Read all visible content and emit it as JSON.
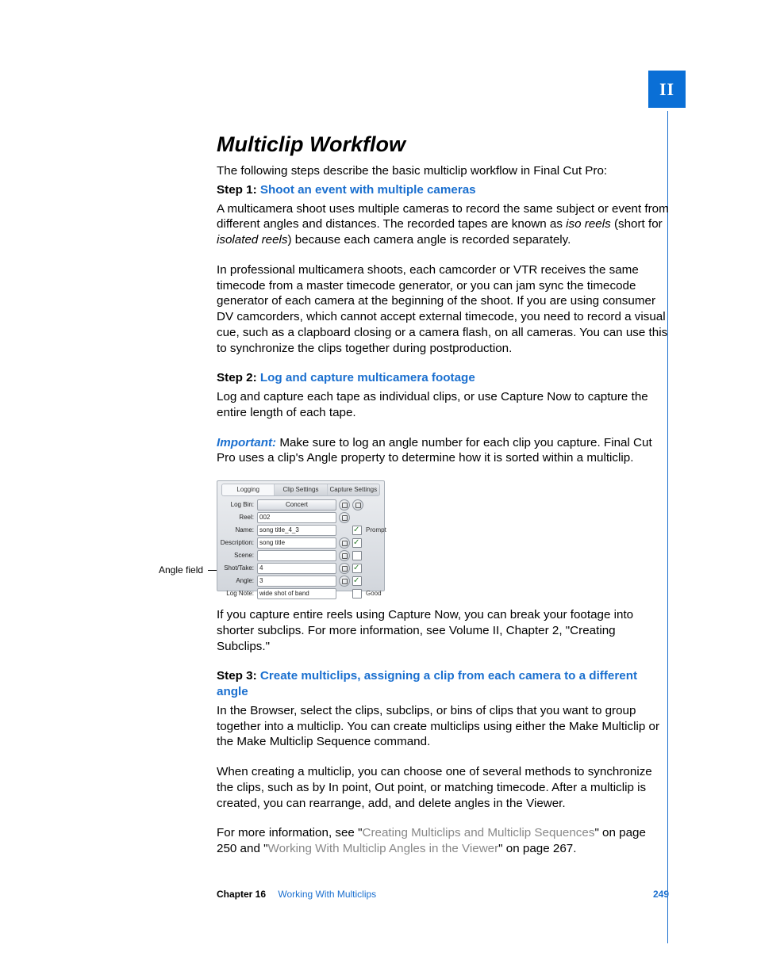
{
  "part_tab": "II",
  "title": "Multiclip Workflow",
  "intro": "The following steps describe the basic multiclip workflow in Final Cut Pro:",
  "step1": {
    "label": "Step 1:",
    "title": "Shoot an event with multiple cameras",
    "p1a": "A multicamera shoot uses multiple cameras to record the same subject or event from different angles and distances. The recorded tapes are known as ",
    "term1": "iso reels",
    "p1b": " (short for ",
    "term2": "isolated reels",
    "p1c": ") because each camera angle is recorded separately.",
    "p2": "In professional multicamera shoots, each camcorder or VTR receives the same timecode from a master timecode generator, or you can jam sync the timecode generator of each camera at the beginning of the shoot. If you are using consumer DV camcorders, which cannot accept external timecode, you need to record a visual cue, such as a clapboard closing or a camera flash, on all cameras. You can use this to synchronize the clips together during postproduction."
  },
  "step2": {
    "label": "Step 2:",
    "title": "Log and capture multicamera footage",
    "p1": "Log and capture each tape as individual clips, or use Capture Now to capture the entire length of each tape.",
    "important_word": "Important:",
    "important_text": "  Make sure to log an angle number for each clip you capture. Final Cut Pro uses a clip's Angle property to determine how it is sorted within a multiclip.",
    "p_after_panel": "If you capture entire reels using Capture Now, you can break your footage into shorter subclips. For more information, see Volume II, Chapter 2, \"Creating Subclips.\""
  },
  "step3": {
    "label": "Step 3:",
    "title": "Create multiclips, assigning a clip from each camera to a different angle",
    "p1": "In the Browser, select the clips, subclips, or bins of clips that you want to group together into a multiclip. You can create multiclips using either the Make Multiclip or the Make Multiclip Sequence command.",
    "p2": "When creating a multiclip, you can choose one of several methods to synchronize the clips, such as by In point, Out point, or matching timecode. After a multiclip is created, you can rearrange, add, and delete angles in the Viewer.",
    "p3a": "For more information, see \"",
    "xref1": "Creating Multiclips and Multiclip Sequences",
    "p3b": "\" on page 250 and \"",
    "xref2": "Working With Multiclip Angles in the Viewer",
    "p3c": "\" on page 267."
  },
  "callout": "Angle field",
  "panel": {
    "tabs": {
      "t1": "Logging",
      "t2": "Clip Settings",
      "t3": "Capture Settings"
    },
    "labels": {
      "log_bin": "Log Bin:",
      "reel": "Reel:",
      "name": "Name:",
      "description": "Description:",
      "scene": "Scene:",
      "shot_take": "Shot/Take:",
      "angle": "Angle:",
      "log_note": "Log Note:"
    },
    "values": {
      "log_bin": "Concert",
      "reel": "002",
      "name": "song title_4_3",
      "description": "song title",
      "scene": "",
      "shot_take": "4",
      "angle": "3",
      "log_note": "wide shot of band"
    },
    "aux": {
      "prompt": "Prompt",
      "good": "Good"
    }
  },
  "footer": {
    "chapter_label": "Chapter 16",
    "chapter_title": "Working With Multiclips",
    "page": "249"
  }
}
